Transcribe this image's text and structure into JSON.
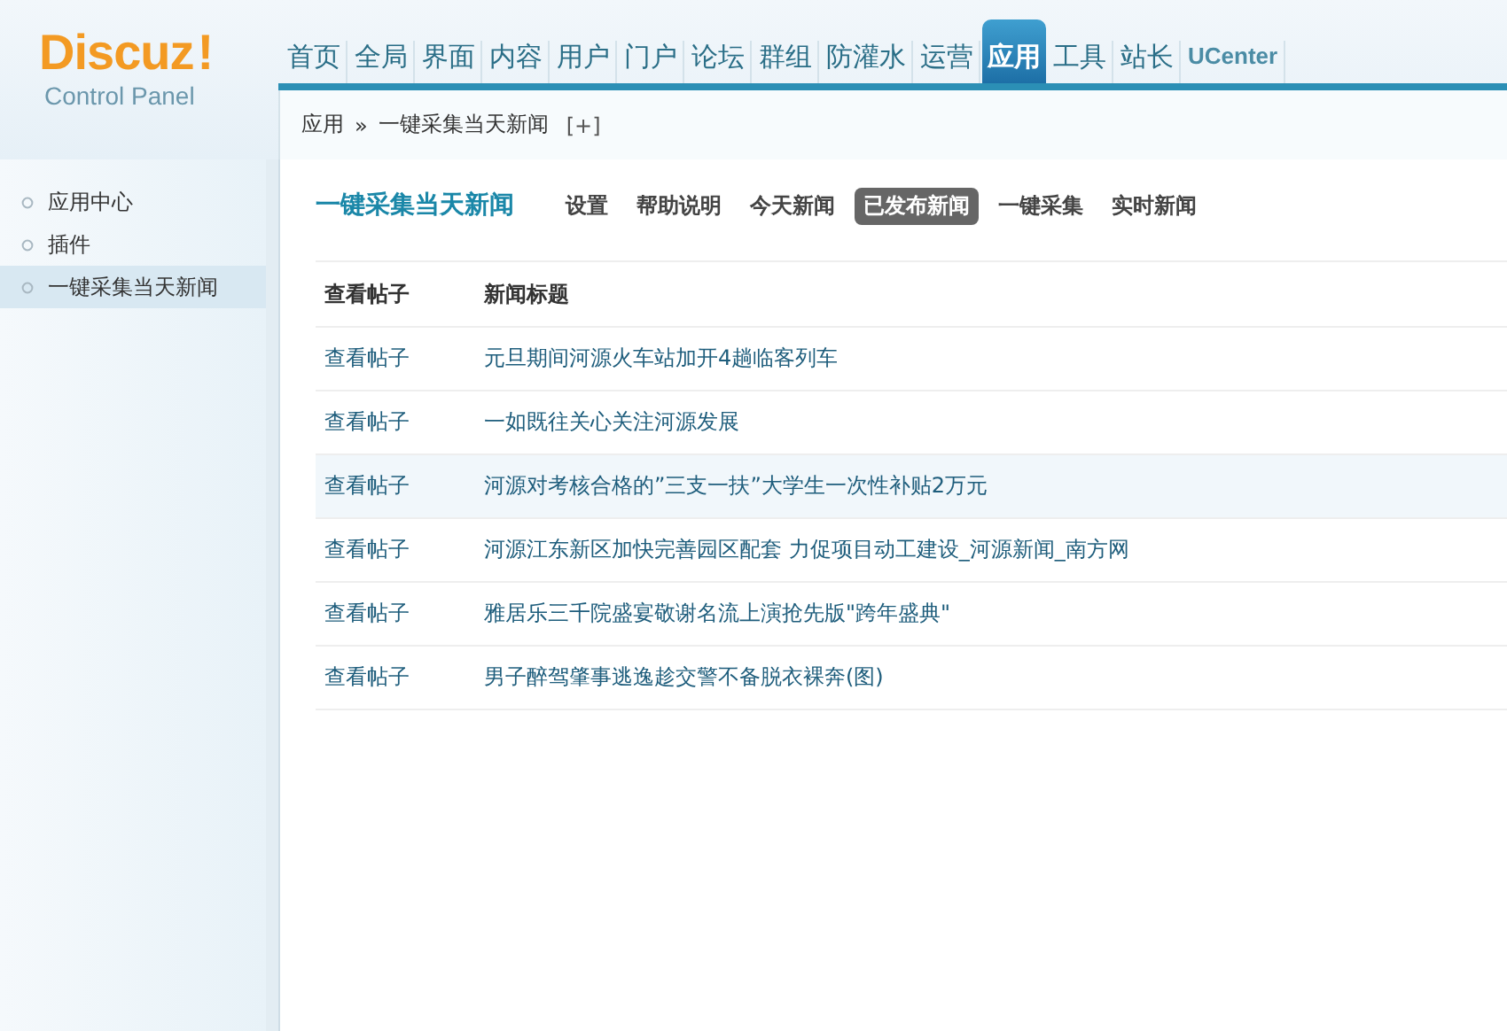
{
  "logo": {
    "name": "Discuz",
    "mark": "!",
    "subtitle": "Control Panel"
  },
  "nav": [
    {
      "label": "首页",
      "selected": false
    },
    {
      "label": "全局",
      "selected": false
    },
    {
      "label": "界面",
      "selected": false
    },
    {
      "label": "内容",
      "selected": false
    },
    {
      "label": "用户",
      "selected": false
    },
    {
      "label": "门户",
      "selected": false
    },
    {
      "label": "论坛",
      "selected": false
    },
    {
      "label": "群组",
      "selected": false
    },
    {
      "label": "防灌水",
      "selected": false
    },
    {
      "label": "运营",
      "selected": false
    },
    {
      "label": "应用",
      "selected": true
    },
    {
      "label": "工具",
      "selected": false
    },
    {
      "label": "站长",
      "selected": false
    },
    {
      "label": "UCenter",
      "selected": false
    }
  ],
  "breadcrumb": {
    "items": [
      "应用",
      "一键采集当天新闻"
    ],
    "separator": "»",
    "add": "[+]"
  },
  "sidebar": {
    "items": [
      {
        "label": "应用中心",
        "selected": false
      },
      {
        "label": "插件",
        "selected": false
      },
      {
        "label": "一键采集当天新闻",
        "selected": true
      }
    ]
  },
  "page_title": "一键采集当天新闻",
  "tabs": [
    {
      "label": "设置",
      "selected": false
    },
    {
      "label": "帮助说明",
      "selected": false
    },
    {
      "label": "今天新闻",
      "selected": false
    },
    {
      "label": "已发布新闻",
      "selected": true
    },
    {
      "label": "一键采集",
      "selected": false
    },
    {
      "label": "实时新闻",
      "selected": false
    }
  ],
  "table": {
    "columns": [
      "查看帖子",
      "新闻标题"
    ],
    "rows": [
      {
        "link": "查看帖子",
        "title": "元旦期间河源火车站加开4趟临客列车",
        "highlighted": false
      },
      {
        "link": "查看帖子",
        "title": "一如既往关心关注河源发展",
        "highlighted": false
      },
      {
        "link": "查看帖子",
        "title": "河源对考核合格的”三支一扶”大学生一次性补贴2万元",
        "highlighted": true
      },
      {
        "link": "查看帖子",
        "title": "河源江东新区加快完善园区配套 力促项目动工建设_河源新闻_南方网",
        "highlighted": false
      },
      {
        "link": "查看帖子",
        "title": "雅居乐三千院盛宴敬谢名流上演抢先版\"跨年盛典\"",
        "highlighted": false
      },
      {
        "link": "查看帖子",
        "title": "男子醉驾肇事逃逸趁交警不备脱衣裸奔(图)",
        "highlighted": false
      }
    ]
  }
}
